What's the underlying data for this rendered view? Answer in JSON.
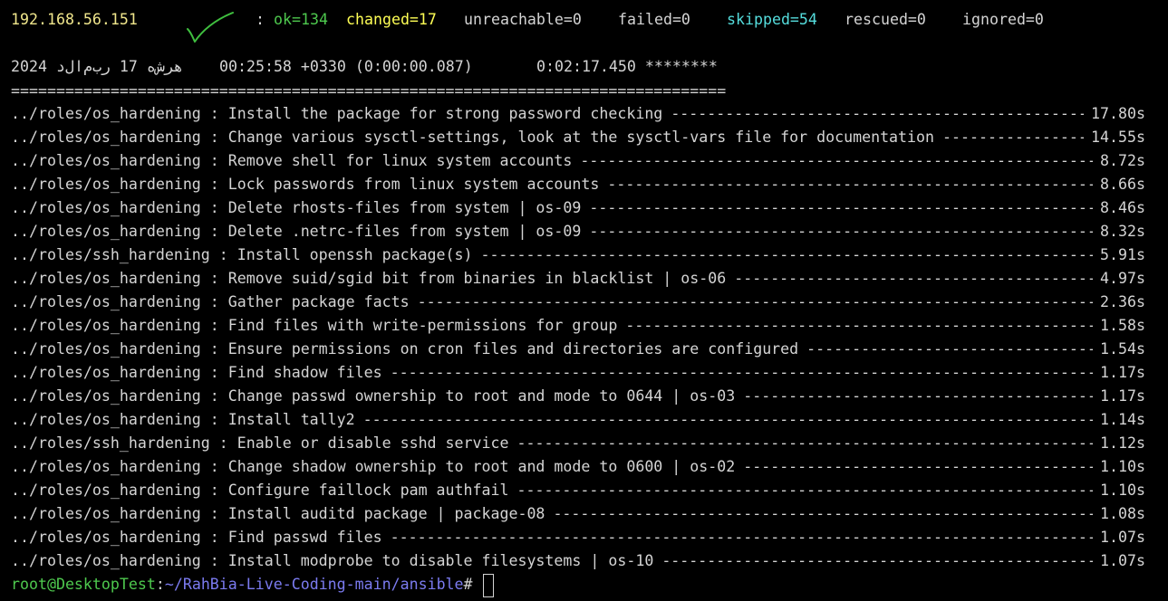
{
  "recap": {
    "host": "192.168.56.151",
    "separator": ":",
    "ok": "ok=134",
    "changed": "changed=17",
    "unreachable": "unreachable=0",
    "failed": "failed=0",
    "skipped": "skipped=54",
    "rescued": "rescued=0",
    "ignored": "ignored=0"
  },
  "colors": {
    "background": "#000000",
    "text": "#d4d4d4",
    "ok": "#4ec94e",
    "changed": "#ffff55",
    "skipped": "#55dddd",
    "path": "#7b7bf0",
    "checkmark": "#3fbf3f"
  },
  "icons": {
    "checkmark": "checkmark-icon"
  },
  "timing": {
    "date": "هرش‌ه 17 رب‌م‌ال‌د 2024",
    "time": "00:25:58 +0330 (0:00:00.087)",
    "elapsed": "0:02:17.450 ********",
    "separator": "==============================================================================="
  },
  "tasks": [
    {
      "name": "../roles/os_hardening : Install the package for strong password checking",
      "time": "17.80s"
    },
    {
      "name": "../roles/os_hardening : Change various sysctl-settings, look at the sysctl-vars file for documentation",
      "time": "14.55s"
    },
    {
      "name": "../roles/os_hardening : Remove shell for linux system accounts",
      "time": "8.72s"
    },
    {
      "name": "../roles/os_hardening : Lock passwords from linux system accounts",
      "time": "8.66s"
    },
    {
      "name": "../roles/os_hardening : Delete rhosts-files from system | os-09",
      "time": "8.46s"
    },
    {
      "name": "../roles/os_hardening : Delete .netrc-files from system | os-09",
      "time": "8.32s"
    },
    {
      "name": "../roles/ssh_hardening : Install openssh package(s)",
      "time": "5.91s"
    },
    {
      "name": "../roles/os_hardening : Remove suid/sgid bit from binaries in blacklist | os-06",
      "time": "4.97s"
    },
    {
      "name": "../roles/os_hardening : Gather package facts",
      "time": "2.36s"
    },
    {
      "name": "../roles/os_hardening : Find files with write-permissions for group",
      "time": "1.58s"
    },
    {
      "name": "../roles/os_hardening : Ensure permissions on cron files and directories are configured",
      "time": "1.54s"
    },
    {
      "name": "../roles/os_hardening : Find shadow files",
      "time": "1.17s"
    },
    {
      "name": "../roles/os_hardening : Change passwd ownership to root and mode to 0644 | os-03",
      "time": "1.17s"
    },
    {
      "name": "../roles/os_hardening : Install tally2",
      "time": "1.14s"
    },
    {
      "name": "../roles/ssh_hardening : Enable or disable sshd service",
      "time": "1.12s"
    },
    {
      "name": "../roles/os_hardening : Change shadow ownership to root and mode to 0600 | os-02",
      "time": "1.10s"
    },
    {
      "name": "../roles/os_hardening : Configure faillock pam authfail",
      "time": "1.10s"
    },
    {
      "name": "../roles/os_hardening : Install auditd package | package-08",
      "time": "1.08s"
    },
    {
      "name": "../roles/os_hardening : Find passwd files",
      "time": "1.07s"
    },
    {
      "name": "../roles/os_hardening : Install modprobe to disable filesystems | os-10",
      "time": "1.07s"
    }
  ],
  "prompt": {
    "user_host": "root@DesktopTest",
    "colon": ":",
    "path": "~/RahBia-Live-Coding-main/ansible",
    "symbol": "#"
  }
}
